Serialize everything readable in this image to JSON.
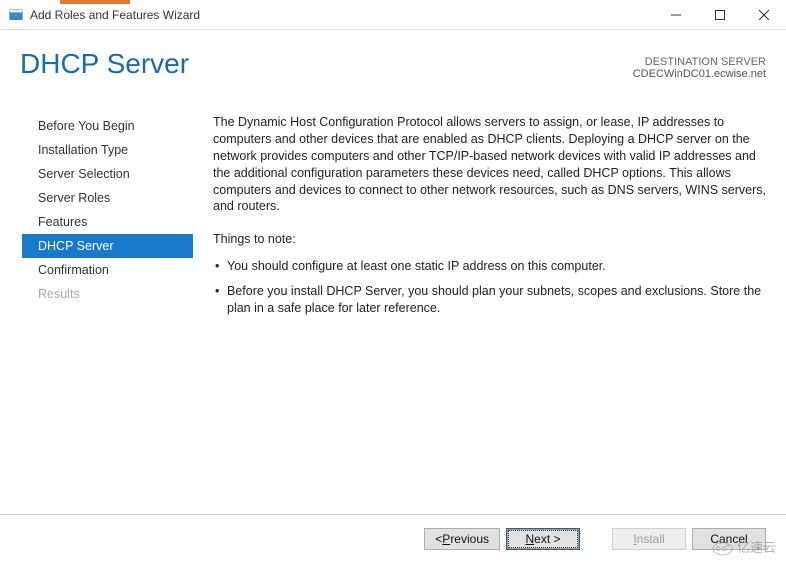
{
  "window": {
    "title": "Add Roles and Features Wizard"
  },
  "header": {
    "page_title": "DHCP Server",
    "destination_label": "DESTINATION SERVER",
    "destination_value": "CDECWinDC01.ecwise.net"
  },
  "sidebar": {
    "items": [
      {
        "label": "Before You Begin",
        "active": false,
        "enabled": true
      },
      {
        "label": "Installation Type",
        "active": false,
        "enabled": true
      },
      {
        "label": "Server Selection",
        "active": false,
        "enabled": true
      },
      {
        "label": "Server Roles",
        "active": false,
        "enabled": true
      },
      {
        "label": "Features",
        "active": false,
        "enabled": true
      },
      {
        "label": "DHCP Server",
        "active": true,
        "enabled": true
      },
      {
        "label": "Confirmation",
        "active": false,
        "enabled": true
      },
      {
        "label": "Results",
        "active": false,
        "enabled": false
      }
    ]
  },
  "content": {
    "intro": "The Dynamic Host Configuration Protocol allows servers to assign, or lease, IP addresses to computers and other devices that are enabled as DHCP clients. Deploying a DHCP server on the network provides computers and other TCP/IP-based network devices with valid IP addresses and the additional configuration parameters these devices need, called DHCP options. This allows computers and devices to connect to other network resources, such as DNS servers, WINS servers, and routers.",
    "notes_label": "Things to note:",
    "bullets": [
      "You should configure at least one static IP address on this computer.",
      "Before you install DHCP Server, you should plan your subnets, scopes and exclusions. Store the plan in a safe place for later reference."
    ]
  },
  "footer": {
    "previous": "< Previous",
    "next": "Next >",
    "install": "Install",
    "cancel": "Cancel"
  },
  "watermark": {
    "text": "亿速云"
  }
}
